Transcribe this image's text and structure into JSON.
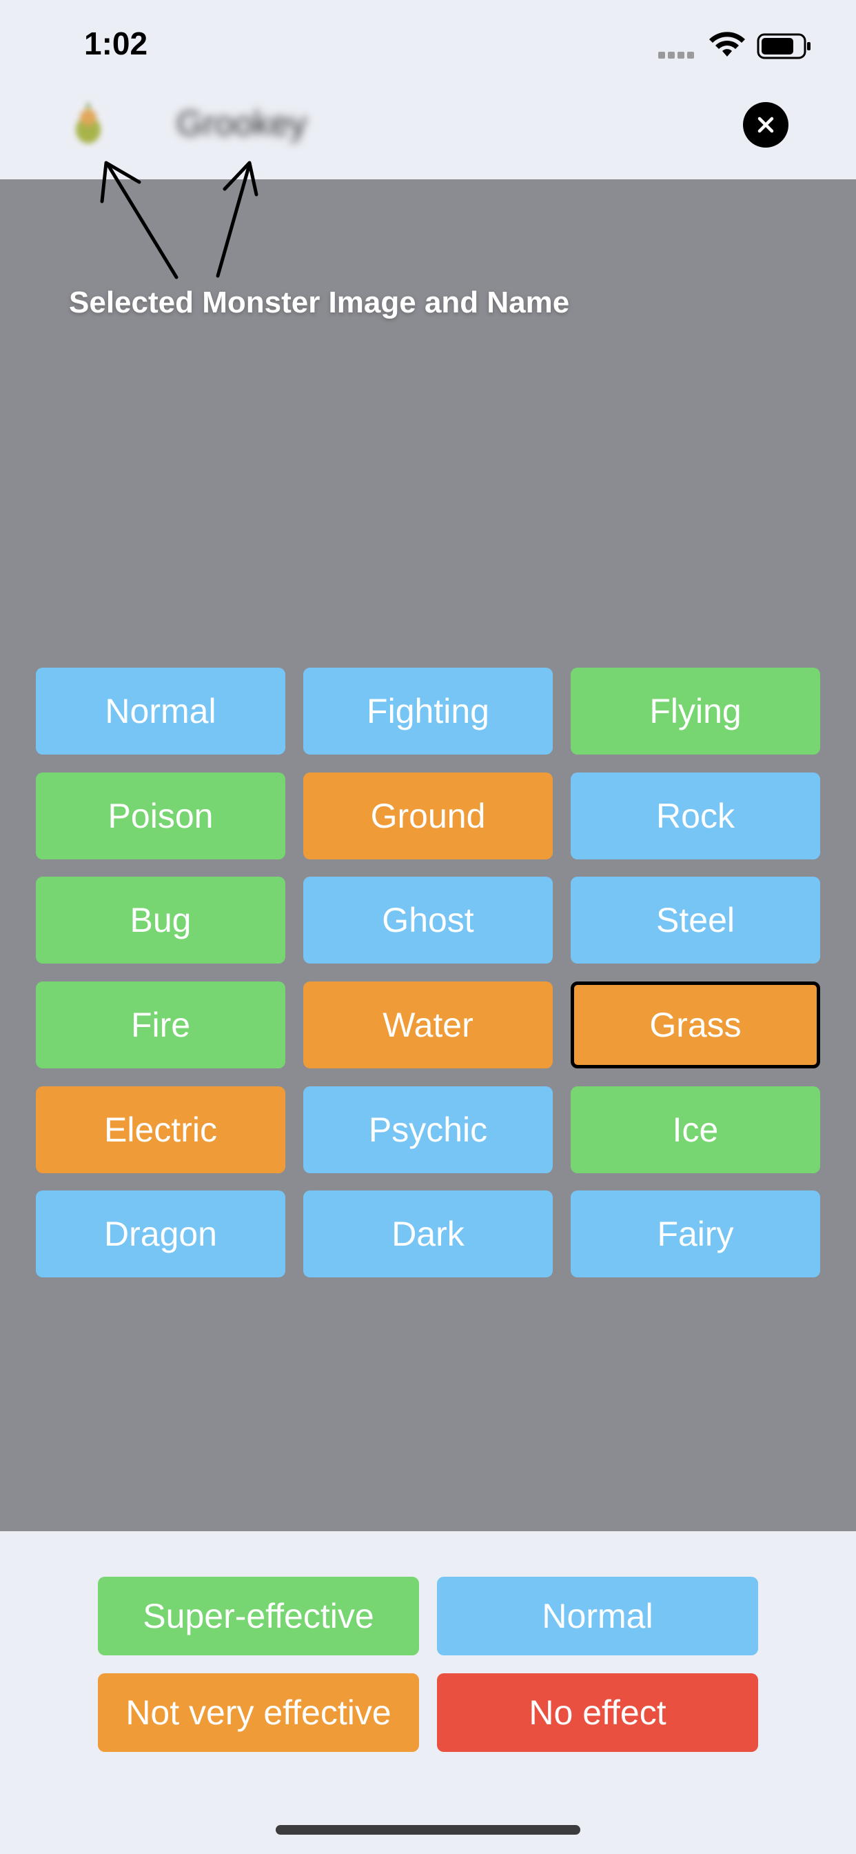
{
  "status_bar": {
    "time": "1:02"
  },
  "header": {
    "monster_name": "Grookey",
    "close_icon": "close-icon",
    "avatar_icon": "monster-avatar"
  },
  "annotation": {
    "text": "Selected Monster Image and Name"
  },
  "types": [
    {
      "label": "Normal",
      "effect": "normal"
    },
    {
      "label": "Fighting",
      "effect": "normal"
    },
    {
      "label": "Flying",
      "effect": "super-effective"
    },
    {
      "label": "Poison",
      "effect": "super-effective"
    },
    {
      "label": "Ground",
      "effect": "not-very-effective"
    },
    {
      "label": "Rock",
      "effect": "normal"
    },
    {
      "label": "Bug",
      "effect": "super-effective"
    },
    {
      "label": "Ghost",
      "effect": "normal"
    },
    {
      "label": "Steel",
      "effect": "normal"
    },
    {
      "label": "Fire",
      "effect": "super-effective"
    },
    {
      "label": "Water",
      "effect": "not-very-effective"
    },
    {
      "label": "Grass",
      "effect": "not-very-effective",
      "selected": true
    },
    {
      "label": "Electric",
      "effect": "not-very-effective"
    },
    {
      "label": "Psychic",
      "effect": "normal"
    },
    {
      "label": "Ice",
      "effect": "super-effective"
    },
    {
      "label": "Dragon",
      "effect": "normal"
    },
    {
      "label": "Dark",
      "effect": "normal"
    },
    {
      "label": "Fairy",
      "effect": "normal"
    }
  ],
  "legend": {
    "super_effective": "Super-effective",
    "normal": "Normal",
    "not_very_effective": "Not very effective",
    "no_effect": "No effect"
  },
  "colors": {
    "super_effective": "#77d672",
    "normal": "#77c5f5",
    "not_very_effective": "#ef9b38",
    "no_effect": "#e95040",
    "overlay": "#8b8c91",
    "background": "#eceef5"
  }
}
